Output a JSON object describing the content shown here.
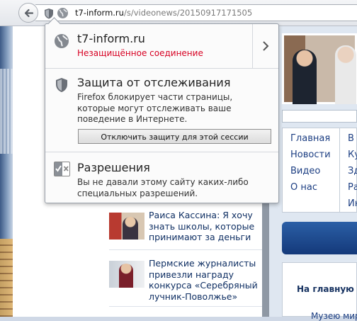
{
  "url": {
    "host": "t7-inform.ru",
    "path": "/s/videonews/20150917171505"
  },
  "identity_popup": {
    "site": {
      "host": "t7-inform.ru",
      "status": "Незащищённое соединение",
      "status_color": "#d70022"
    },
    "tracking": {
      "title": "Защита от отслеживания",
      "description": "Firefox блокирует части страницы, которые могут отслеживать ваше поведение в Интернете.",
      "disable_button": "Отключить защиту для этой сессии"
    },
    "permissions": {
      "title": "Разрешения",
      "description": "Вы не давали этому сайту каких-либо специальных разрешений."
    }
  },
  "news": [
    {
      "title": "Раиса Кассина: Я хочу знать школы, которые принимают за деньги"
    },
    {
      "title": "Пермские журналисты привезли награду конкурса «Серебряный лучник-Поволжье»"
    }
  ],
  "side_menu": [
    "Главная",
    "Новости",
    "Видео",
    "О нас"
  ],
  "side_menu_cut": [
    "В",
    "Ку",
    "Зд",
    "Ра",
    "Ин"
  ],
  "lower_box": {
    "home_link": "На главную -",
    "cut_text": "Музею мира"
  },
  "colors": {
    "link": "#1c3e82",
    "news_title": "#0f2f63"
  }
}
